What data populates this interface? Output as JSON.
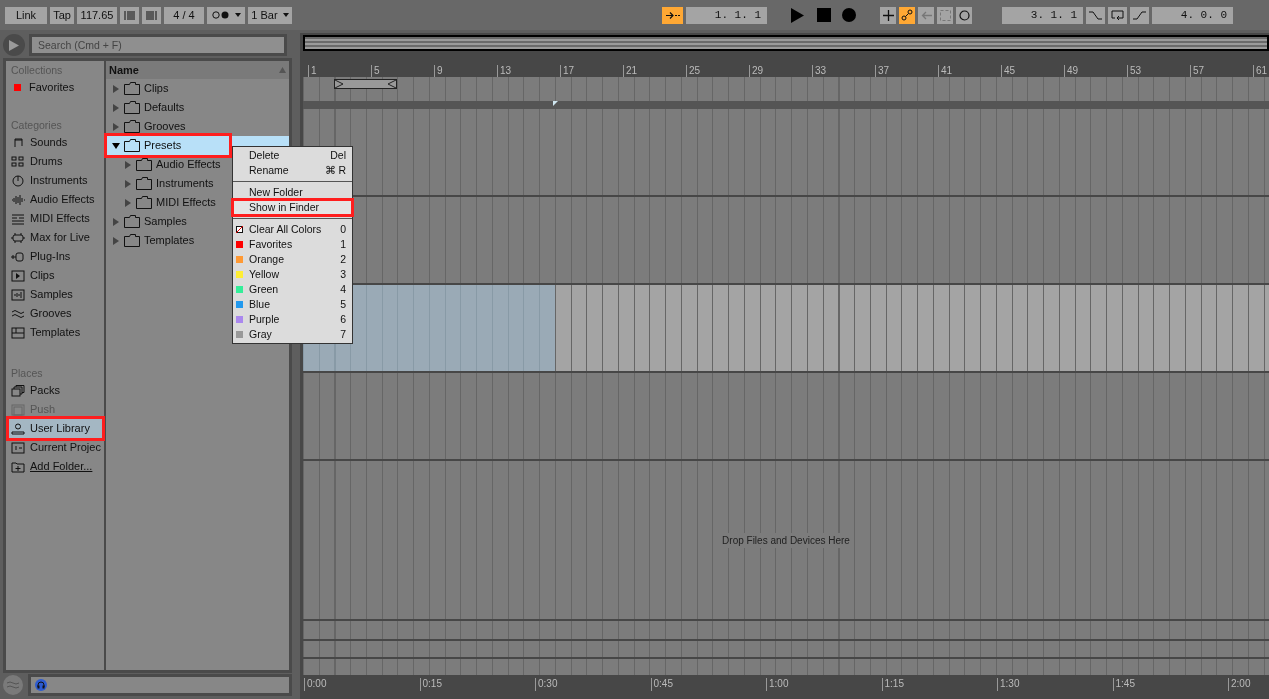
{
  "transport": {
    "link": "Link",
    "tap": "Tap",
    "tempo": "117.65",
    "signature": "4 / 4",
    "quantize": "1 Bar",
    "follow_on": true,
    "position": "1. 1. 1",
    "tools": [
      {
        "kind": "add",
        "on": false
      },
      {
        "kind": "automation",
        "on": true
      },
      {
        "kind": "back",
        "on": false
      },
      {
        "kind": "capture",
        "on": false
      },
      {
        "kind": "record",
        "on": false
      }
    ],
    "loop_start": "3. 1. 1",
    "loop_length": "4. 0. 0"
  },
  "browser": {
    "search": {
      "placeholder": "Search (Cmd + F)"
    },
    "sections": [
      {
        "title": "Collections",
        "items": [
          {
            "kind": "color",
            "label": "Favorites",
            "color": "#ff0000",
            "selected": false,
            "disabled": false,
            "highlighted": false
          }
        ]
      },
      {
        "title": "Categories",
        "items": [
          {
            "kind": "sounds",
            "label": "Sounds",
            "selected": false,
            "disabled": false,
            "highlighted": false
          },
          {
            "kind": "drums",
            "label": "Drums",
            "selected": false,
            "disabled": false,
            "highlighted": false
          },
          {
            "kind": "instruments",
            "label": "Instruments",
            "selected": false,
            "disabled": false,
            "highlighted": false
          },
          {
            "kind": "audio",
            "label": "Audio Effects",
            "selected": false,
            "disabled": false,
            "highlighted": false
          },
          {
            "kind": "midi",
            "label": "MIDI Effects",
            "selected": false,
            "disabled": false,
            "highlighted": false
          },
          {
            "kind": "max",
            "label": "Max for Live",
            "selected": false,
            "disabled": false,
            "highlighted": false
          },
          {
            "kind": "plugin",
            "label": "Plug-Ins",
            "selected": false,
            "disabled": false,
            "highlighted": false
          },
          {
            "kind": "clips",
            "label": "Clips",
            "selected": false,
            "disabled": false,
            "highlighted": false
          },
          {
            "kind": "samples",
            "label": "Samples",
            "selected": false,
            "disabled": false,
            "highlighted": false
          },
          {
            "kind": "grooves",
            "label": "Grooves",
            "selected": false,
            "disabled": false,
            "highlighted": false
          },
          {
            "kind": "templates",
            "label": "Templates",
            "selected": false,
            "disabled": false,
            "highlighted": false
          }
        ]
      },
      {
        "title": "Places",
        "items": [
          {
            "kind": "packs",
            "label": "Packs",
            "selected": false,
            "disabled": false,
            "highlighted": false
          },
          {
            "kind": "push",
            "label": "Push",
            "selected": false,
            "disabled": true,
            "highlighted": false
          },
          {
            "kind": "user",
            "label": "User Library",
            "selected": true,
            "disabled": false,
            "highlighted": true
          },
          {
            "kind": "project",
            "label": "Current Projec",
            "selected": false,
            "disabled": false,
            "highlighted": false
          },
          {
            "kind": "add",
            "label": "Add Folder...",
            "selected": false,
            "disabled": false,
            "highlighted": false
          }
        ]
      }
    ],
    "column": "Name",
    "tree": [
      {
        "label": "Clips",
        "expanded": false,
        "selected": false,
        "highlighted": false
      },
      {
        "label": "Defaults",
        "expanded": false,
        "selected": false,
        "highlighted": false
      },
      {
        "label": "Grooves",
        "expanded": false,
        "selected": false,
        "highlighted": false
      },
      {
        "label": "Presets",
        "expanded": true,
        "selected": true,
        "highlighted": true,
        "children": [
          {
            "label": "Audio Effects",
            "expanded": false,
            "selected": false,
            "highlighted": false
          },
          {
            "label": "Instruments",
            "expanded": false,
            "selected": false,
            "highlighted": false
          },
          {
            "label": "MIDI Effects",
            "expanded": false,
            "selected": false,
            "highlighted": false
          }
        ]
      },
      {
        "label": "Samples",
        "expanded": false,
        "selected": false,
        "highlighted": false
      },
      {
        "label": "Templates",
        "expanded": false,
        "selected": false,
        "highlighted": false
      }
    ]
  },
  "context_menu": {
    "groups": [
      [
        {
          "kind": "command",
          "label": "Delete",
          "shortcut": "Del",
          "highlighted": false
        },
        {
          "kind": "command",
          "label": "Rename",
          "shortcut": "⌘ R",
          "highlighted": false
        }
      ],
      [
        {
          "kind": "command",
          "label": "New Folder",
          "highlighted": false
        },
        {
          "kind": "command",
          "label": "Show in Finder",
          "highlighted": true
        }
      ],
      [
        {
          "kind": "clear",
          "label": "Clear All Colors",
          "shortcut": "0",
          "highlighted": false
        },
        {
          "kind": "color",
          "label": "Favorites",
          "shortcut": "1",
          "color": "#ff0000",
          "highlighted": false
        },
        {
          "kind": "color",
          "label": "Orange",
          "shortcut": "2",
          "color": "#ff9933",
          "highlighted": false
        },
        {
          "kind": "color",
          "label": "Yellow",
          "shortcut": "3",
          "color": "#ffee33",
          "highlighted": false
        },
        {
          "kind": "color",
          "label": "Green",
          "shortcut": "4",
          "color": "#33ee99",
          "highlighted": false
        },
        {
          "kind": "color",
          "label": "Blue",
          "shortcut": "5",
          "color": "#2299ee",
          "highlighted": false
        },
        {
          "kind": "color",
          "label": "Purple",
          "shortcut": "6",
          "color": "#aa88ee",
          "highlighted": false
        },
        {
          "kind": "color",
          "label": "Gray",
          "shortcut": "7",
          "color": "#999999",
          "highlighted": false
        }
      ]
    ]
  },
  "arrangement": {
    "bars": [
      "1",
      "5",
      "9",
      "13",
      "17",
      "21",
      "25",
      "29",
      "33",
      "37",
      "41",
      "45",
      "49",
      "53",
      "57",
      "61"
    ],
    "tracks": [
      {
        "selected": false
      },
      {
        "selected": false
      },
      {
        "selected": true
      },
      {
        "selected": false
      }
    ],
    "drop_hint": "Drop Files and Devices Here",
    "times": [
      "0:00",
      "0:15",
      "0:30",
      "0:45",
      "1:00",
      "1:15",
      "1:30",
      "1:45",
      "2:00"
    ]
  }
}
